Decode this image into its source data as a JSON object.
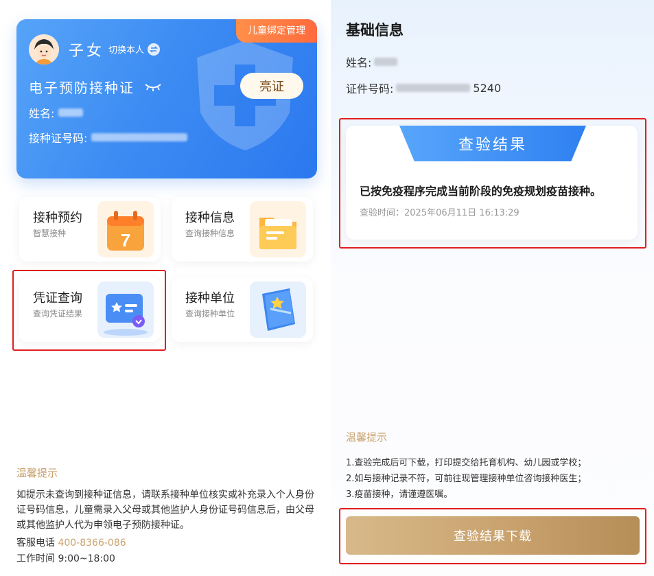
{
  "left": {
    "card": {
      "bind_tag": "儿童绑定管理",
      "role": "子女",
      "switch_label": "切换本人",
      "cert_title": "电子预防接种证",
      "show_button": "亮证",
      "name_label": "姓名:",
      "cert_no_label": "接种证号码:"
    },
    "tiles": [
      {
        "title": "接种预约",
        "subtitle": "智慧接种",
        "icon": "calendar-icon",
        "day": "7"
      },
      {
        "title": "接种信息",
        "subtitle": "查询接种信息",
        "icon": "folder-icon"
      },
      {
        "title": "凭证查询",
        "subtitle": "查询凭证结果",
        "icon": "certificate-icon"
      },
      {
        "title": "接种单位",
        "subtitle": "查询接种单位",
        "icon": "book-icon"
      }
    ],
    "tips": {
      "title": "温馨提示",
      "body": "如提示未查询到接种证信息，请联系接种单位核实或补充录入个人身份证号码信息，儿童需录入父母或其他监护人身份证号码信息后，由父母或其他监护人代为申领电子预防接种证。",
      "hotline_label": "客服电话",
      "hotline": "400-8366-086",
      "hours": "工作时间 9:00~18:00"
    }
  },
  "right": {
    "heading": "基础信息",
    "name_label": "姓名:",
    "id_label": "证件号码:",
    "id_suffix": "5240",
    "result": {
      "banner": "查验结果",
      "text": "已按免疫程序完成当前阶段的免疫规划疫苗接种。",
      "time": "查验时间：2025年06月11日 16:13:29"
    },
    "tips": {
      "title": "温馨提示",
      "items": [
        "1.查验完成后可下载，打印提交给托育机构、幼儿园或学校；",
        "2.如与接种记录不符，可前往现管理接种单位咨询接种医生；",
        "3.疫苗接种，请谨遵医嘱。"
      ]
    },
    "download_button": "查验结果下载"
  },
  "colors": {
    "card_blue": "#3d8cf3",
    "tag_orange": "#ff6a3d",
    "gold": "#c9a26e",
    "highlight_red": "#e01e1e"
  }
}
